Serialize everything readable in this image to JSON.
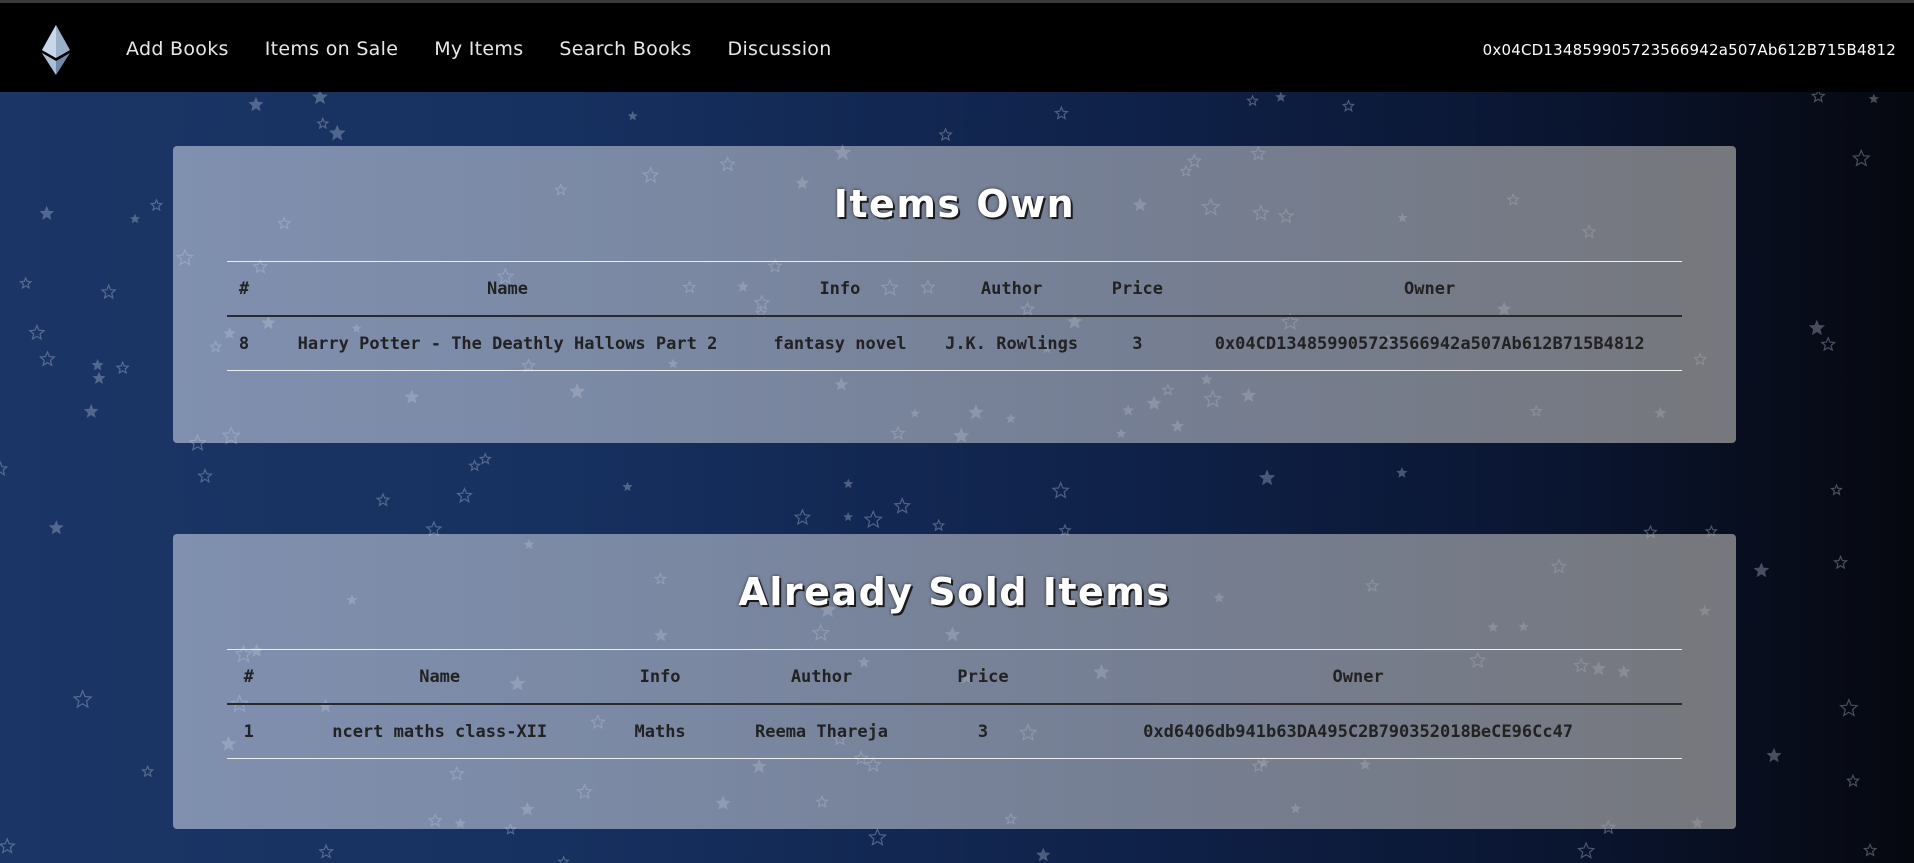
{
  "nav": {
    "links": [
      "Add Books",
      "Items on Sale",
      "My Items",
      "Search Books",
      "Discussion"
    ],
    "account": "0x04CD134859905723566942a507Ab612B715B4812"
  },
  "items_own": {
    "title": "Items Own",
    "headers": [
      "#",
      "Name",
      "Info",
      "Author",
      "Price",
      "Owner"
    ],
    "row": {
      "id": "8",
      "name": "Harry Potter - The Deathly Hallows Part 2",
      "info": "fantasy novel",
      "author": "J.K. Rowlings",
      "price": "3",
      "owner": "0x04CD134859905723566942a507Ab612B715B4812"
    }
  },
  "sold_items": {
    "title": "Already Sold Items",
    "headers": [
      "#",
      "Name",
      "Info",
      "Author",
      "Price",
      "Owner"
    ],
    "row": {
      "id": "1",
      "name": "ncert maths class-XII",
      "info": "Maths",
      "author": "Reema Thareja",
      "price": "3",
      "owner": "0xd6406db941b63DA495C2B790352018BeCE96Cc47"
    }
  }
}
